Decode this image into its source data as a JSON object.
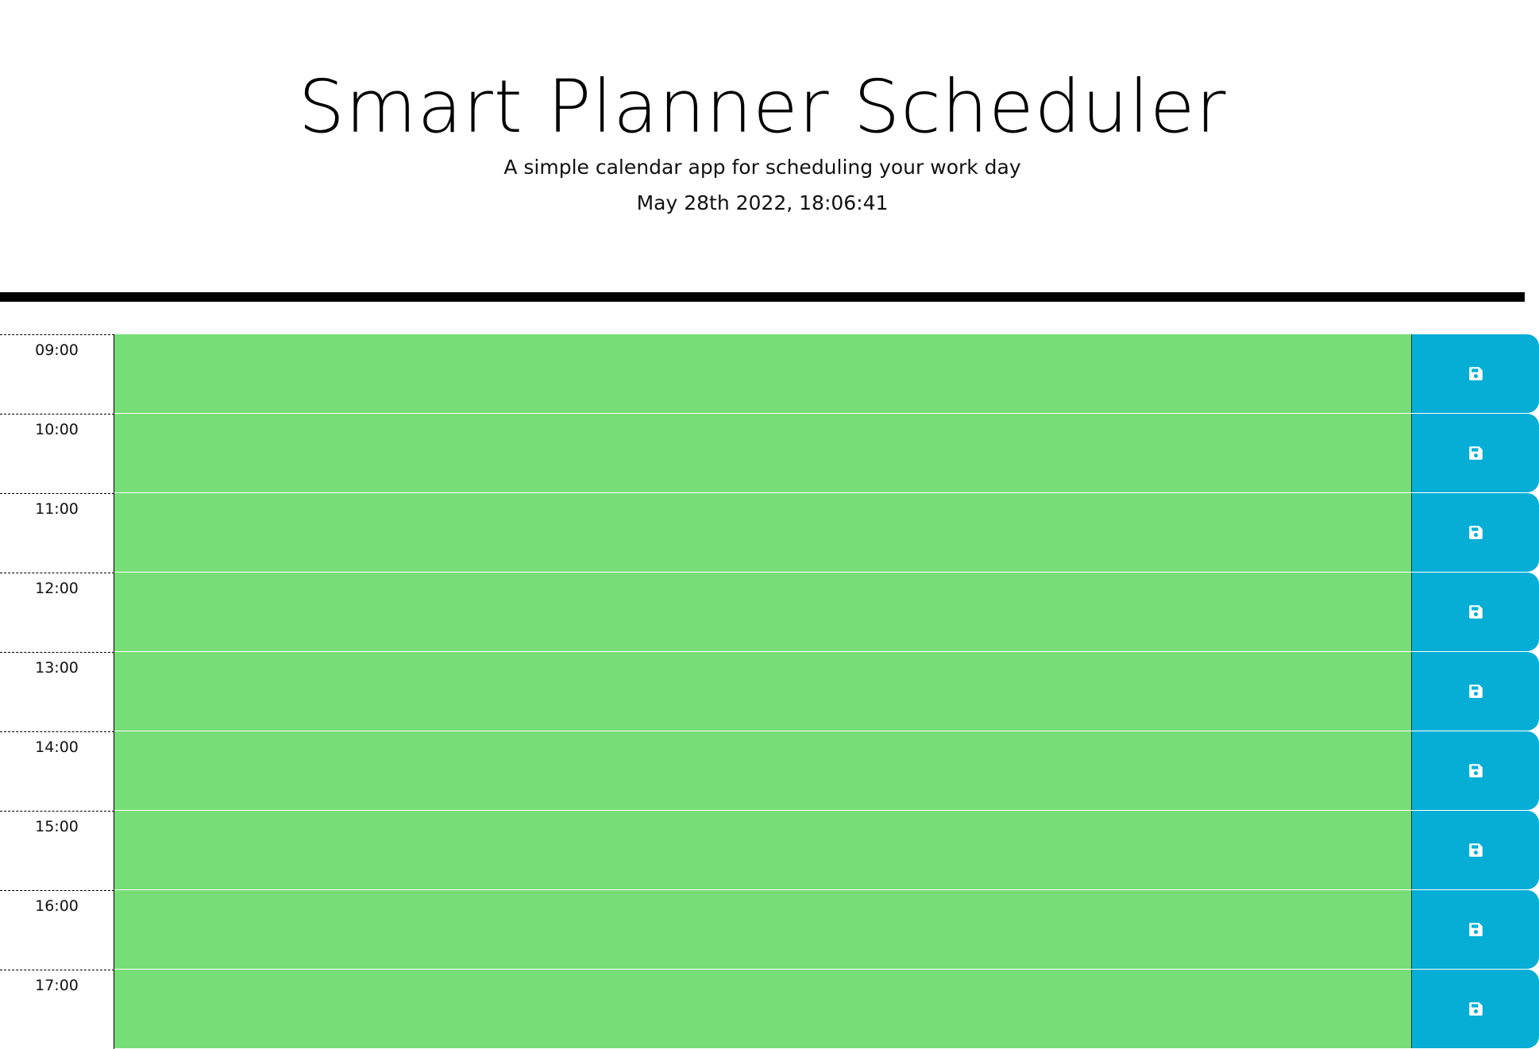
{
  "header": {
    "title": "Smart Planner Scheduler",
    "subtitle": "A simple calendar app for scheduling your work day",
    "current_datetime": "May 28th 2022, 18:06:41"
  },
  "time_blocks": [
    {
      "hour": "09:00",
      "text": ""
    },
    {
      "hour": "10:00",
      "text": ""
    },
    {
      "hour": "11:00",
      "text": ""
    },
    {
      "hour": "12:00",
      "text": ""
    },
    {
      "hour": "13:00",
      "text": ""
    },
    {
      "hour": "14:00",
      "text": ""
    },
    {
      "hour": "15:00",
      "text": ""
    },
    {
      "hour": "16:00",
      "text": ""
    },
    {
      "hour": "17:00",
      "text": ""
    }
  ],
  "icons": {
    "save": "save-icon"
  },
  "colors": {
    "future_block": "#77dd77",
    "save_button": "#06aed5",
    "divider": "#000000"
  }
}
